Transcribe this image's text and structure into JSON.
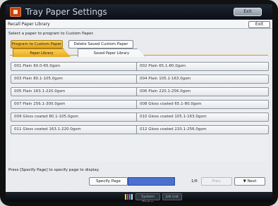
{
  "window": {
    "title": "Tray Paper Settings",
    "exit_label": "Exit"
  },
  "header": {
    "title": "Recall Paper Library",
    "exit_label": "Exit"
  },
  "instruction": "Select a paper to program to Custom Paper.",
  "actions": {
    "program_label": "Program to Custom Paper",
    "delete_label": "Delete Saved Custom Paper"
  },
  "tabs": [
    {
      "label": "Paper Library",
      "active": true
    },
    {
      "label": "Saved Paper Library",
      "active": false
    }
  ],
  "papers": [
    "001 Plain 60.0-65.0gsm",
    "002 Plain 65.1-80.0gsm",
    "003 Plain 80.1-105.0gsm",
    "004 Plain 105.1-163.0gsm",
    "005 Plain 163.1-220.0gsm",
    "006 Plain 220.1-256.0gsm",
    "007 Plain 256.1-300.0gsm",
    "008 Gloss coated 65.1-80.0gsm",
    "009 Gloss coated 80.1-105.0gsm",
    "010 Gloss coated 105.1-163.0gsm",
    "011 Gloss coated 163.1-220.0gsm",
    "012 Gloss coated 220.1-256.0gsm"
  ],
  "footer": {
    "note": "Press [Specify Page] to specify page to display.",
    "specify_label": "Specify Page",
    "page_count": "1/6",
    "prev_label": "Prev.",
    "next_label": "▼ Next"
  },
  "statusbar": {
    "button1_label": "System Status",
    "button2_label": "Job List"
  },
  "colors": {
    "accent": "#f0b429",
    "specify_field": "#4d6fd0",
    "title_bar": "#0b0f16"
  },
  "icons": {
    "title": "printer-settings-icon",
    "toner": "toner-level-icon"
  }
}
